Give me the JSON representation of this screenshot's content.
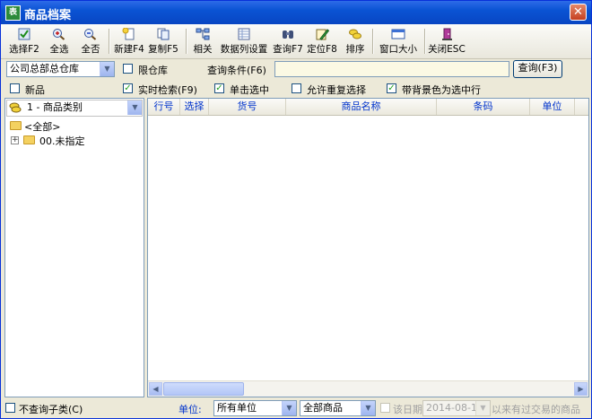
{
  "window": {
    "title": "商品档案",
    "app_icon": "spreadsheet-app-icon",
    "close_label": "✕"
  },
  "toolbar": {
    "items": [
      {
        "label": "选择F2",
        "icon": "checklist-icon"
      },
      {
        "label": "全选",
        "icon": "zoom-in-icon"
      },
      {
        "label": "全否",
        "icon": "zoom-out-icon"
      },
      {
        "label": "新建F4",
        "icon": "new-document-icon"
      },
      {
        "label": "复制F5",
        "icon": "copy-icon"
      },
      {
        "label": "相关",
        "icon": "relation-tree-icon"
      },
      {
        "label": "数据列设置",
        "icon": "column-settings-icon"
      },
      {
        "label": "查询F7",
        "icon": "binoculars-icon"
      },
      {
        "label": "定位F8",
        "icon": "locate-pencil-icon"
      },
      {
        "label": "排序",
        "icon": "sort-coins-icon"
      },
      {
        "label": "窗口大小",
        "icon": "window-size-icon"
      },
      {
        "label": "关闭ESC",
        "icon": "close-door-icon"
      }
    ]
  },
  "filters": {
    "warehouse": "公司总部总仓库",
    "limit_warehouse_label": "限仓库",
    "limit_warehouse_checked": false,
    "query_condition_label": "查询条件(F6)",
    "query_value": "",
    "query_button": "查询(F3)",
    "new_goods_label": "新品",
    "new_goods_checked": false,
    "realtime_search_label": "实时检索(F9)",
    "realtime_search_checked": true,
    "single_click_label": "单击选中",
    "single_click_checked": true,
    "allow_repeat_label": "允许重复选择",
    "allow_repeat_checked": false,
    "highlight_label": "带背景色为选中行",
    "highlight_checked": true
  },
  "category": {
    "selector": "1 - 商品类别",
    "tree": [
      {
        "label": "<全部>"
      },
      {
        "label": "00.未指定",
        "expander": "+"
      }
    ]
  },
  "grid": {
    "columns": [
      "行号",
      "选择",
      "货号",
      "商品名称",
      "条码",
      "单位"
    ],
    "rows": []
  },
  "status": {
    "no_subcategory_label": "不查询子类(C)",
    "no_subcategory_checked": false,
    "unit_label": "单位:",
    "unit_value": "所有单位",
    "goods_scope_value": "全部商品",
    "date_label": "该日期",
    "date_value": "2014-08-11",
    "date_enabled": false,
    "traded_since_label": "以来有过交易的商品"
  }
}
